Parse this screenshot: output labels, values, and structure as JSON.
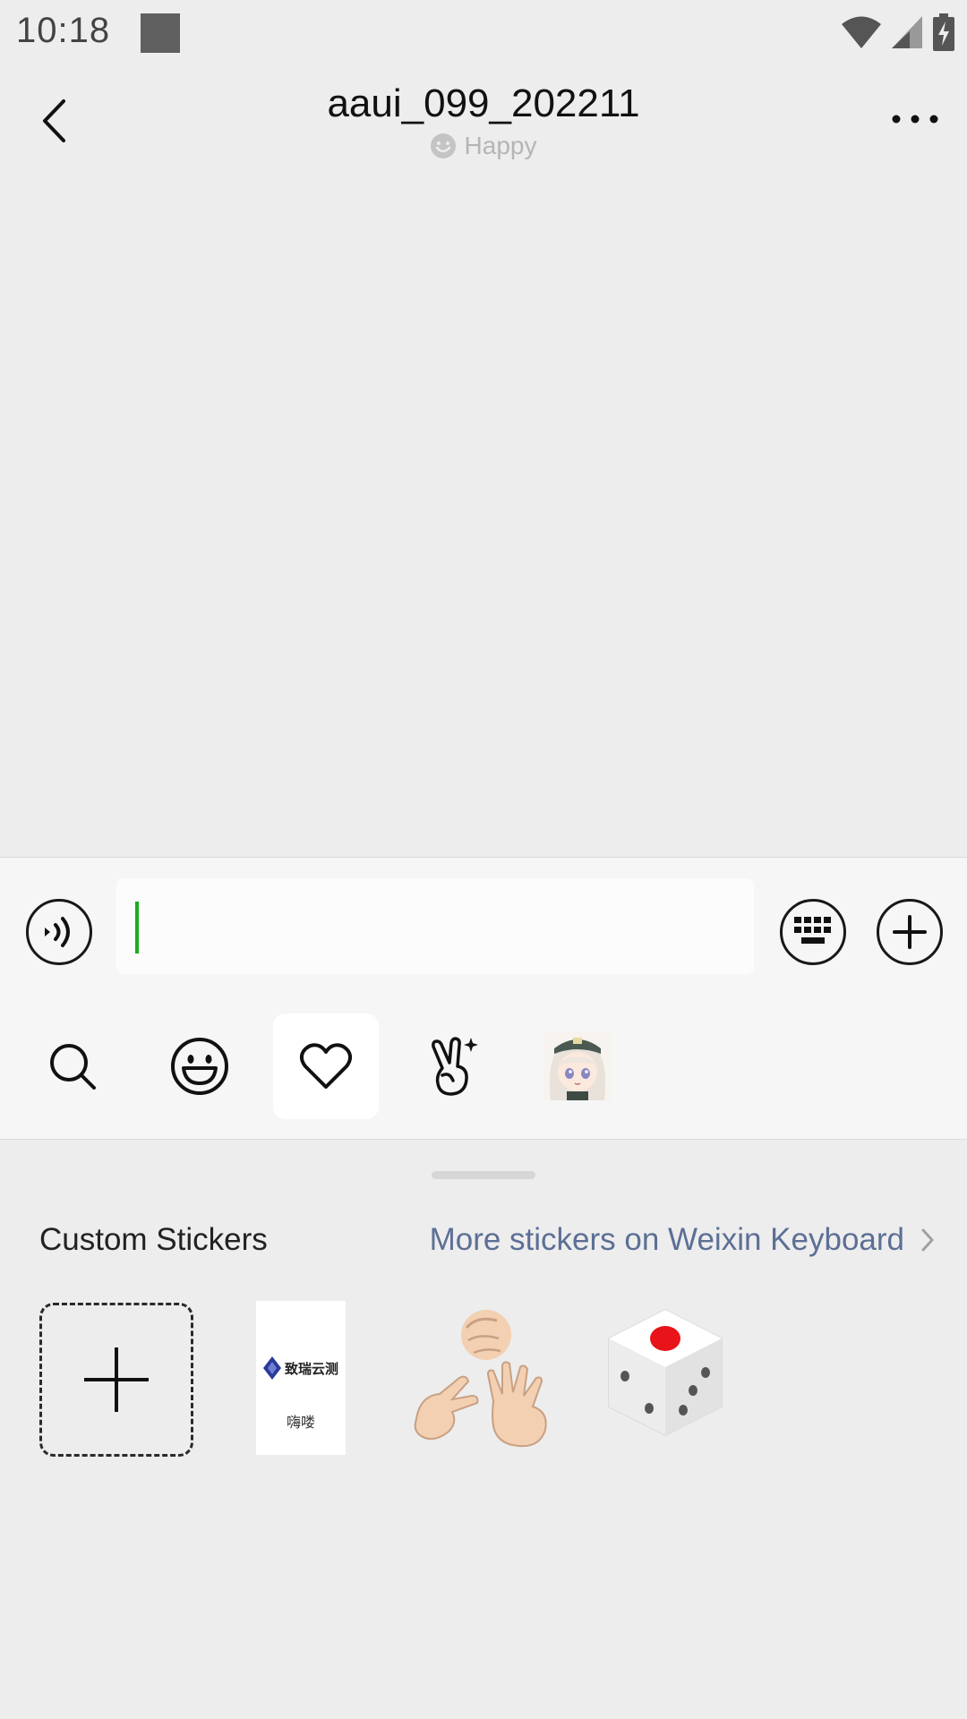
{
  "status_bar": {
    "time": "10:18",
    "icons": [
      "notification-square-icon",
      "wifi-icon",
      "signal-icon",
      "battery-charging-icon"
    ]
  },
  "header": {
    "title": "aaui_099_202211",
    "status_icon": "smiley-icon",
    "status_text": "Happy",
    "back_icon": "back-arrow-icon",
    "more_icon": "more-dots-icon"
  },
  "input_bar": {
    "value": "",
    "voice_icon": "voice-icon",
    "keyboard_icon": "keyboard-icon",
    "plus_icon": "plus-icon",
    "caret_color": "#1aad19"
  },
  "sticker_tabs": {
    "items": [
      {
        "icon": "search-icon",
        "active": false
      },
      {
        "icon": "emoji-icon",
        "active": false
      },
      {
        "icon": "heart-icon",
        "active": true
      },
      {
        "icon": "victory-hand-icon",
        "active": false
      },
      {
        "icon": "anime-avatar-icon",
        "active": false
      }
    ]
  },
  "sticker_panel": {
    "section_label": "Custom Stickers",
    "more_link": "More stickers on Weixin Keyboard",
    "link_color": "#5c6f95",
    "stickers": [
      {
        "icon": "add-sticker-icon"
      },
      {
        "icon": "document-sticker",
        "logo_text": "致瑞云测",
        "caption": "嗨喽"
      },
      {
        "icon": "rock-paper-scissors-sticker"
      },
      {
        "icon": "dice-sticker"
      }
    ]
  }
}
